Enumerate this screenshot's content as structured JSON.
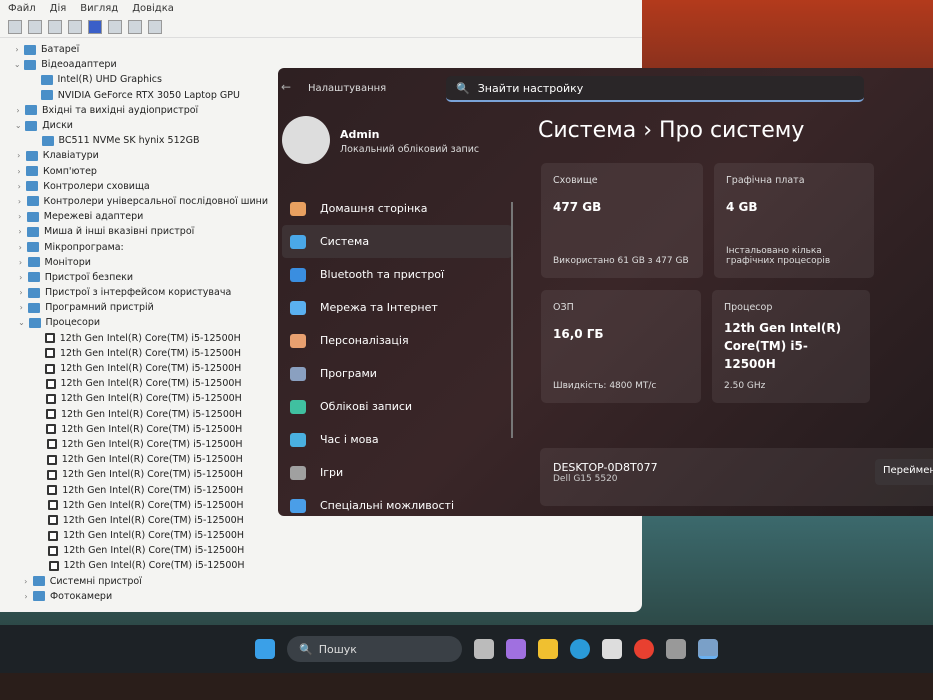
{
  "device_manager": {
    "menu": [
      "Файл",
      "Дія",
      "Вигляд",
      "Довідка"
    ],
    "tree": [
      {
        "label": "Батареї",
        "level": 0,
        "expanded": false
      },
      {
        "label": "Відеоадаптери",
        "level": 0,
        "expanded": true
      },
      {
        "label": "Intel(R) UHD Graphics",
        "level": 1
      },
      {
        "label": "NVIDIA GeForce RTX 3050 Laptop GPU",
        "level": 1
      },
      {
        "label": "Вхідні та вихідні аудіопристрої",
        "level": 0,
        "expanded": false
      },
      {
        "label": "Диски",
        "level": 0,
        "expanded": true
      },
      {
        "label": "BC511 NVMe SK hynix 512GB",
        "level": 1
      },
      {
        "label": "Клавіатури",
        "level": 0,
        "expanded": false
      },
      {
        "label": "Комп'ютер",
        "level": 0,
        "expanded": false
      },
      {
        "label": "Контролери сховища",
        "level": 0,
        "expanded": false
      },
      {
        "label": "Контролери універсальної послідовної шини",
        "level": 0,
        "expanded": false
      },
      {
        "label": "Мережеві адаптери",
        "level": 0,
        "expanded": false
      },
      {
        "label": "Миша й інші вказівні пристрої",
        "level": 0,
        "expanded": false
      },
      {
        "label": "Мікропрограма:",
        "level": 0,
        "expanded": false
      },
      {
        "label": "Монітори",
        "level": 0,
        "expanded": false
      },
      {
        "label": "Пристрої безпеки",
        "level": 0,
        "expanded": false
      },
      {
        "label": "Пристрої з інтерфейсом користувача",
        "level": 0,
        "expanded": false
      },
      {
        "label": "Програмний пристрій",
        "level": 0,
        "expanded": false
      },
      {
        "label": "Процесори",
        "level": 0,
        "expanded": true
      },
      {
        "label": "12th Gen Intel(R) Core(TM) i5-12500H",
        "level": 1,
        "cpu": true
      },
      {
        "label": "12th Gen Intel(R) Core(TM) i5-12500H",
        "level": 1,
        "cpu": true
      },
      {
        "label": "12th Gen Intel(R) Core(TM) i5-12500H",
        "level": 1,
        "cpu": true
      },
      {
        "label": "12th Gen Intel(R) Core(TM) i5-12500H",
        "level": 1,
        "cpu": true
      },
      {
        "label": "12th Gen Intel(R) Core(TM) i5-12500H",
        "level": 1,
        "cpu": true
      },
      {
        "label": "12th Gen Intel(R) Core(TM) i5-12500H",
        "level": 1,
        "cpu": true
      },
      {
        "label": "12th Gen Intel(R) Core(TM) i5-12500H",
        "level": 1,
        "cpu": true
      },
      {
        "label": "12th Gen Intel(R) Core(TM) i5-12500H",
        "level": 1,
        "cpu": true
      },
      {
        "label": "12th Gen Intel(R) Core(TM) i5-12500H",
        "level": 1,
        "cpu": true
      },
      {
        "label": "12th Gen Intel(R) Core(TM) i5-12500H",
        "level": 1,
        "cpu": true
      },
      {
        "label": "12th Gen Intel(R) Core(TM) i5-12500H",
        "level": 1,
        "cpu": true
      },
      {
        "label": "12th Gen Intel(R) Core(TM) i5-12500H",
        "level": 1,
        "cpu": true
      },
      {
        "label": "12th Gen Intel(R) Core(TM) i5-12500H",
        "level": 1,
        "cpu": true
      },
      {
        "label": "12th Gen Intel(R) Core(TM) i5-12500H",
        "level": 1,
        "cpu": true
      },
      {
        "label": "12th Gen Intel(R) Core(TM) i5-12500H",
        "level": 1,
        "cpu": true
      },
      {
        "label": "12th Gen Intel(R) Core(TM) i5-12500H",
        "level": 1,
        "cpu": true
      },
      {
        "label": "Системні пристрої",
        "level": 0,
        "expanded": false
      },
      {
        "label": "Фотокамери",
        "level": 0,
        "expanded": false
      }
    ]
  },
  "settings": {
    "title": "Налаштування",
    "search_placeholder": "Знайти настройку",
    "user": {
      "name": "Admin",
      "type": "Локальний обліковий запис"
    },
    "nav": [
      {
        "label": "Домашня сторінка",
        "color": "#e8a060"
      },
      {
        "label": "Система",
        "color": "#4aa8e8",
        "selected": true
      },
      {
        "label": "Bluetooth та пристрої",
        "color": "#3a8ee0"
      },
      {
        "label": "Мережа та Інтернет",
        "color": "#5ab0f0"
      },
      {
        "label": "Персоналізація",
        "color": "#e8a070"
      },
      {
        "label": "Програми",
        "color": "#8aa0c0"
      },
      {
        "label": "Облікові записи",
        "color": "#40c0a0"
      },
      {
        "label": "Час і мова",
        "color": "#4ab0e0"
      },
      {
        "label": "Ігри",
        "color": "#a0a0a0"
      },
      {
        "label": "Спеціальні можливості",
        "color": "#4a9ee8"
      }
    ],
    "breadcrumb": {
      "parent": "Система",
      "sep": "›",
      "current": "Про систему"
    },
    "cards": {
      "storage": {
        "label": "Сховище",
        "value": "477 GB",
        "foot": "Використано 61 GB з 477 GB"
      },
      "gpu": {
        "label": "Графічна плата",
        "value": "4 GB",
        "foot": "Інстальовано кілька графічних процесорів"
      },
      "ram": {
        "label": "ОЗП",
        "value": "16,0 ГБ",
        "foot": "Швидкість: 4800 МТ/с"
      },
      "cpu": {
        "label": "Процесор",
        "value": "12th Gen Intel(R) Core(TM) i5-12500H",
        "foot": "2.50 GHz"
      }
    },
    "device": {
      "name": "DESKTOP-0D8T077",
      "model": "Dell G15 5520",
      "rename": "Перейменувати"
    }
  },
  "taskbar": {
    "search": "Пошук"
  }
}
